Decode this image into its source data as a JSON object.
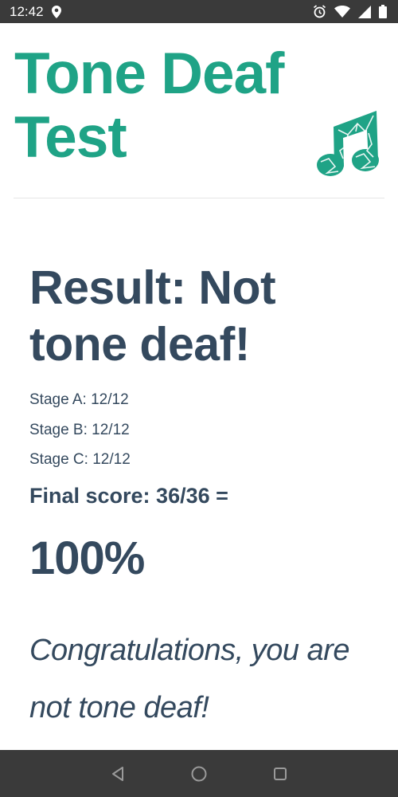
{
  "status_bar": {
    "time": "12:42",
    "icons": [
      "location-icon",
      "alarm-icon",
      "wifi-icon",
      "signal-icon",
      "battery-icon"
    ]
  },
  "header": {
    "title": "Tone Deaf Test",
    "logo_icon": "music-note-icon",
    "accent_color": "#1fa386"
  },
  "result": {
    "heading": "Result: Not tone deaf!",
    "stages": [
      "Stage A: 12/12",
      "Stage B: 12/12",
      "Stage C: 12/12"
    ],
    "final_score": "Final score: 36/36 =",
    "percent": "100%",
    "message": "Congratulations, you are not tone deaf!",
    "text_color": "#34495e"
  },
  "nav_bar": {
    "buttons": [
      "back-icon",
      "home-icon",
      "recents-icon"
    ]
  }
}
